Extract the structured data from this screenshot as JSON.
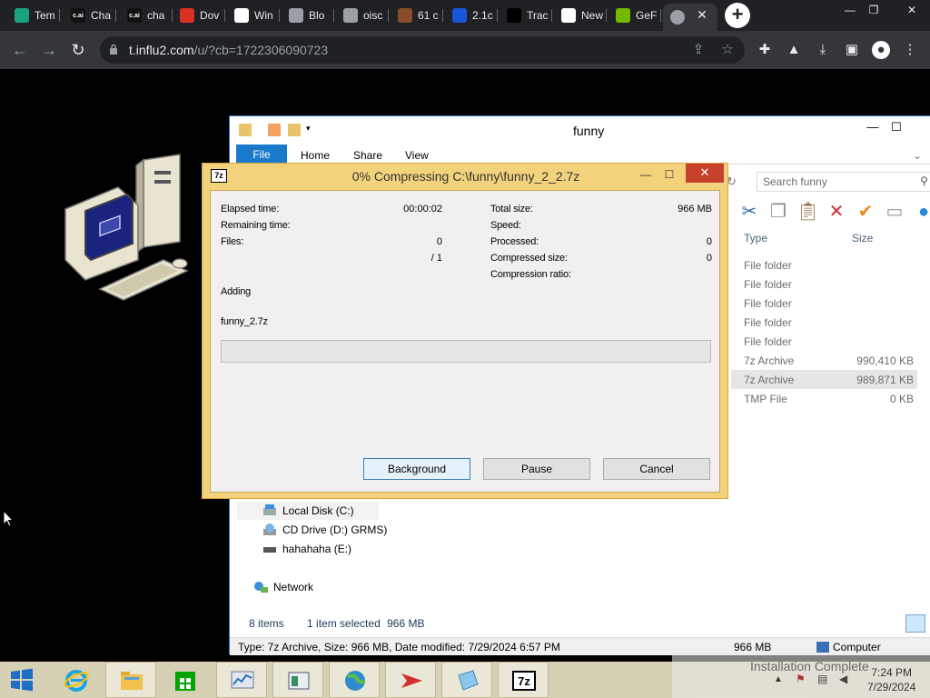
{
  "browser": {
    "tabs": [
      {
        "label": "Tem",
        "color": "#19a37f"
      },
      {
        "label": "Cha",
        "color": "#111111",
        "mark": "c.ai"
      },
      {
        "label": "cha",
        "color": "#111111",
        "mark": "c.ai"
      },
      {
        "label": "Dov",
        "color": "#d93025"
      },
      {
        "label": "Win",
        "color": "#ffffff"
      },
      {
        "label": "Blo",
        "color": "#9aa0a6"
      },
      {
        "label": "oisc",
        "color": "#9aa0a6"
      },
      {
        "label": "61 c",
        "color": "#8a4b2a"
      },
      {
        "label": "2.1c",
        "color": "#1a56db"
      },
      {
        "label": "Trac",
        "color": "#000000"
      },
      {
        "label": "New",
        "color": "#ffffff"
      },
      {
        "label": "GeF",
        "color": "#76b900"
      }
    ],
    "url_host": "t.influ2.com",
    "url_path": "/u/?cb=1722306090723"
  },
  "explorer": {
    "title": "funny",
    "ribbon_tabs": [
      "File",
      "Home",
      "Share",
      "View"
    ],
    "search_placeholder": "Search funny",
    "columns": {
      "type": "Type",
      "size": "Size"
    },
    "rows": [
      {
        "type": "File folder",
        "size": ""
      },
      {
        "type": "File folder",
        "size": ""
      },
      {
        "type": "File folder",
        "size": ""
      },
      {
        "type": "File folder",
        "size": ""
      },
      {
        "type": "File folder",
        "size": ""
      },
      {
        "type": "7z Archive",
        "size": "990,410 KB"
      },
      {
        "type": "7z Archive",
        "size": "989,871 KB",
        "selected": true
      },
      {
        "type": "TMP File",
        "size": "0 KB"
      }
    ],
    "nav": [
      "Local Disk (C:)",
      "CD Drive (D:) GRMS)",
      "hahahaha (E:)",
      "Network"
    ],
    "status": {
      "items": "8 items",
      "selected": "1 item selected",
      "size": "966 MB"
    },
    "details": {
      "info": "Type: 7z Archive, Size: 966 MB, Date modified: 7/29/2024 6:57 PM",
      "size": "966 MB",
      "location": "Computer"
    }
  },
  "dialog": {
    "title": "0% Compressing C:\\funny\\funny_2_2.7z",
    "left": {
      "elapsed_label": "Elapsed time:",
      "elapsed": "00:00:02",
      "remaining_label": "Remaining time:",
      "remaining": "",
      "files_label": "Files:",
      "files": "0",
      "files_total": "/ 1"
    },
    "right": {
      "total_label": "Total size:",
      "total": "966 MB",
      "speed_label": "Speed:",
      "speed": "",
      "processed_label": "Processed:",
      "processed": "0",
      "compressed_label": "Compressed size:",
      "compressed": "0",
      "ratio_label": "Compression ratio:",
      "ratio": ""
    },
    "action": "Adding",
    "filename": "funny_2.7z",
    "progress": 0,
    "buttons": {
      "background": "Background",
      "pause": "Pause",
      "cancel": "Cancel"
    }
  },
  "taskbar": {
    "notification": "Installation Complete",
    "time": "7:24 PM",
    "date": "7/29/2024"
  }
}
